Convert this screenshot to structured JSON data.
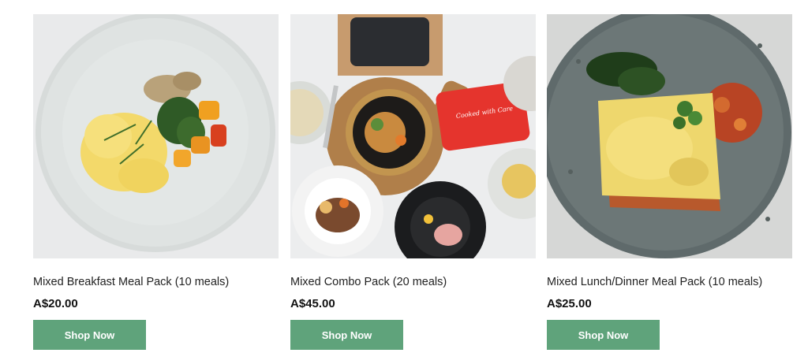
{
  "products": [
    {
      "title": "Mixed Breakfast Meal Pack (10 meals)",
      "price": "A$20.00",
      "button_label": "Shop Now",
      "image": "breakfast-plate-image"
    },
    {
      "title": "Mixed Combo Pack (20 meals)",
      "price": "A$45.00",
      "button_label": "Shop Now",
      "image": "combo-pack-image",
      "image_text": "Cooked with Care"
    },
    {
      "title": "Mixed Lunch/Dinner Meal Pack (10 meals)",
      "price": "A$25.00",
      "button_label": "Shop Now",
      "image": "lasagna-plate-image"
    }
  ],
  "colors": {
    "button": "#5fa37b",
    "button_text": "#ffffff",
    "price": "#111111"
  }
}
